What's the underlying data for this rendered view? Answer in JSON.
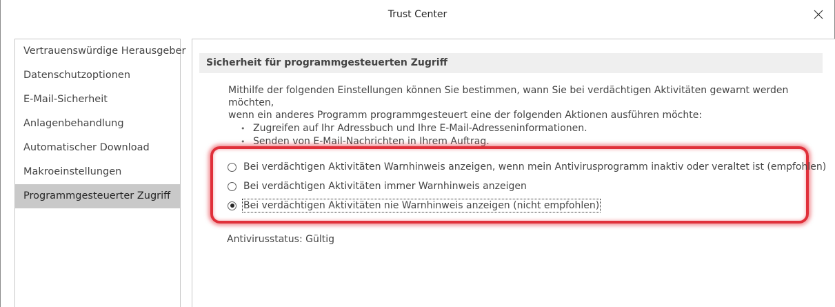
{
  "window": {
    "title": "Trust Center",
    "close_icon": "close-icon"
  },
  "sidebar": {
    "items": [
      {
        "label": "Vertrauenswürdige Herausgeber",
        "selected": false
      },
      {
        "label": "Datenschutzoptionen",
        "selected": false
      },
      {
        "label": "E-Mail-Sicherheit",
        "selected": false
      },
      {
        "label": "Anlagenbehandlung",
        "selected": false
      },
      {
        "label": "Automatischer Download",
        "selected": false
      },
      {
        "label": "Makroeinstellungen",
        "selected": false
      },
      {
        "label": "Programmgesteuerter Zugriff",
        "selected": true
      }
    ]
  },
  "main": {
    "section_title": "Sicherheit für programmgesteuerten Zugriff",
    "description_line1": "Mithilfe der folgenden Einstellungen können Sie bestimmen, wann Sie bei verdächtigen Aktivitäten gewarnt werden möchten,",
    "description_line2": "wenn ein anderes Programm programmgesteuert eine der folgenden Aktionen ausführen möchte:",
    "bullets": [
      "Zugreifen auf Ihr Adressbuch und Ihre E-Mail-Adresseninformationen.",
      "Senden von E-Mail-Nachrichten in Ihrem Auftrag."
    ],
    "options": [
      {
        "label": "Bei verdächtigen Aktivitäten Warnhinweis anzeigen, wenn mein Antivirusprogramm inaktiv oder veraltet ist (empfohlen)",
        "checked": false
      },
      {
        "label": "Bei verdächtigen Aktivitäten immer Warnhinweis anzeigen",
        "checked": false
      },
      {
        "label": "Bei verdächtigen Aktivitäten nie Warnhinweis anzeigen (nicht empfohlen)",
        "checked": true
      }
    ],
    "antivirus_status": "Antivirusstatus: Gültig"
  },
  "colors": {
    "highlight": "#e0303a",
    "selected_item": "#c9c9c9",
    "section_header_bg": "#efefef"
  }
}
